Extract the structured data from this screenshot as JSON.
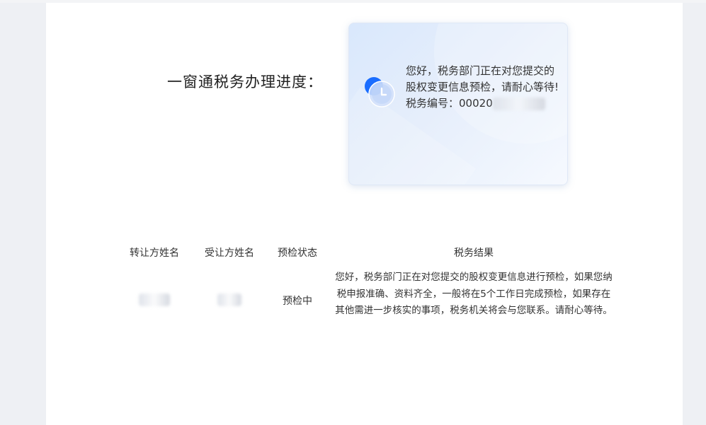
{
  "progress": {
    "title": "一窗通税务办理进度："
  },
  "card": {
    "icon": "clock-icon",
    "message": "您好，税务部门正在对您提交的股权变更信息预检，请耐心等待!",
    "tax_number_label": "税务编号：",
    "tax_number_value": "00020",
    "accent_color": "#1a6dff"
  },
  "table": {
    "headers": [
      "转让方姓名",
      "受让方姓名",
      "预检状态",
      "税务结果"
    ],
    "rows": [
      {
        "transferor": "",
        "transferee": "",
        "status": "预检中",
        "result": "您好，税务部门正在对您提交的股权变更信息进行预检，如果您纳税申报准确、资料齐全，一般将在5个工作日完成预检，如果存在其他需进一步核实的事项，税务机关将会与您联系。请耐心等待。"
      }
    ]
  }
}
